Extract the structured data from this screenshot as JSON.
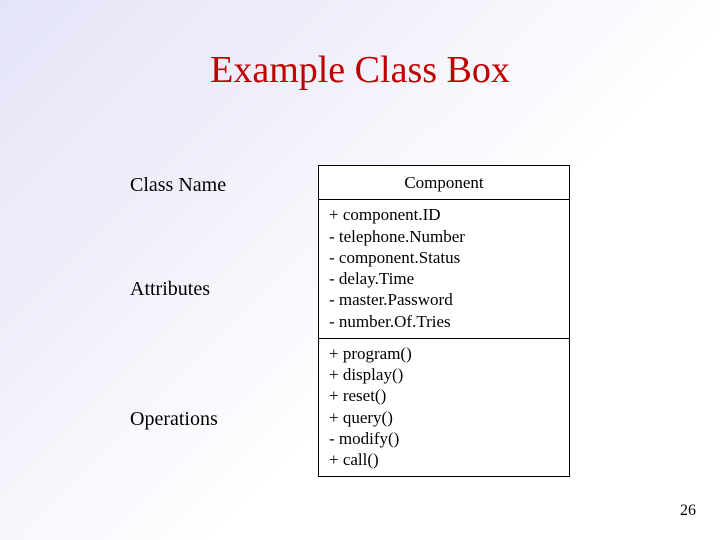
{
  "title": "Example Class Box",
  "labels": {
    "className": "Class Name",
    "attributes": "Attributes",
    "operations": "Operations"
  },
  "uml": {
    "className": "Component",
    "attributes": [
      "+ component.ID",
      "- telephone.Number",
      "- component.Status",
      "- delay.Time",
      "- master.Password",
      "- number.Of.Tries"
    ],
    "operations": [
      "+ program()",
      "+ display()",
      "+ reset()",
      "+ query()",
      "- modify()",
      "+ call()"
    ]
  },
  "pageNumber": "26"
}
